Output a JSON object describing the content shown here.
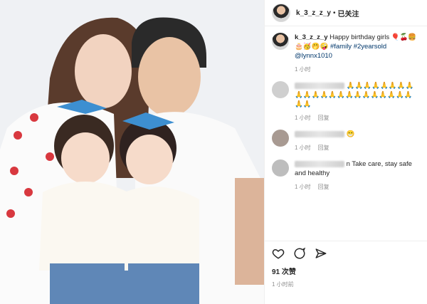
{
  "header": {
    "username": "k_3_z_z_y",
    "dot": "•",
    "follow_label": "已关注"
  },
  "caption": {
    "username": "k_3_z_z_y",
    "text": "Happy birthday girls",
    "emojis": "🎈🍒🍔🎂🥳🤭🤪",
    "hashtags": "#family #2yearsold",
    "mention": "@lynnx1010",
    "time": "1 小时"
  },
  "comments": [
    {
      "username": "",
      "text": "🙏🙏🙏🙏🙏🙏🙏🙏🙏🙏🙏🙏🙏🙏🙏🙏🙏🙏🙏🙏🙏🙏🙏🙏",
      "time": "1 小时",
      "reply": "回复"
    },
    {
      "username": "",
      "text": "😁",
      "time": "1 小时",
      "reply": "回复"
    },
    {
      "username": "",
      "text": "n Take care, stay safe and healthy",
      "time": "1 小时",
      "reply": "回复"
    }
  ],
  "likes_text": "91 次赞",
  "post_time": "1 小时前",
  "icons": {
    "like": "heart-icon",
    "comment": "comment-icon",
    "share": "share-icon"
  }
}
